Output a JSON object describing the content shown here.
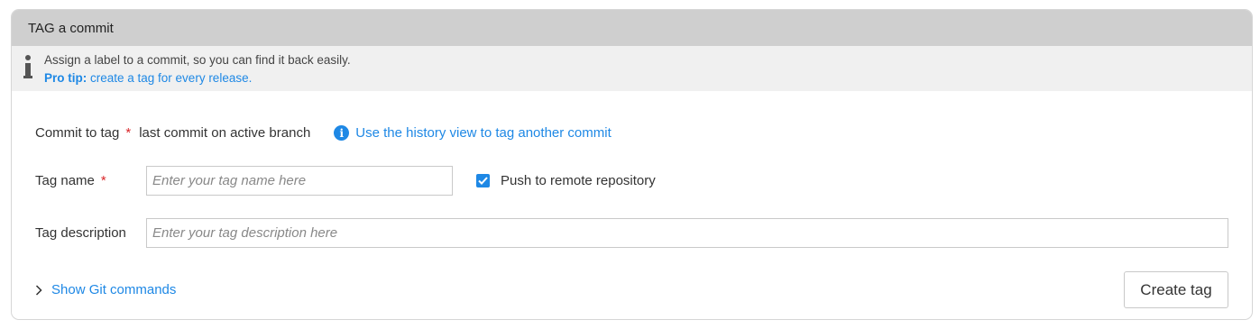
{
  "header": {
    "title": "TAG  a commit"
  },
  "tip": {
    "line1": "Assign a label to a commit, so you can find it back easily.",
    "pro_label": "Pro tip:",
    "pro_text": " create a tag for every release."
  },
  "commit_row": {
    "label": "Commit to tag",
    "required": "*",
    "value": "last commit on active branch",
    "history_link": "Use the history view to tag another commit"
  },
  "tag_name": {
    "label": "Tag name",
    "required": "*",
    "placeholder": "Enter your tag name here"
  },
  "push": {
    "label": "Push to remote repository",
    "checked": true
  },
  "tag_description": {
    "label": "Tag description",
    "placeholder": "Enter your tag description here"
  },
  "git_commands": {
    "label": "Show Git commands"
  },
  "create_button": {
    "label": "Create tag"
  },
  "colors": {
    "accent": "#1e88e5",
    "required": "#d9262a",
    "header_bg": "#cfcfcf",
    "tip_bg": "#f0f0f0"
  }
}
